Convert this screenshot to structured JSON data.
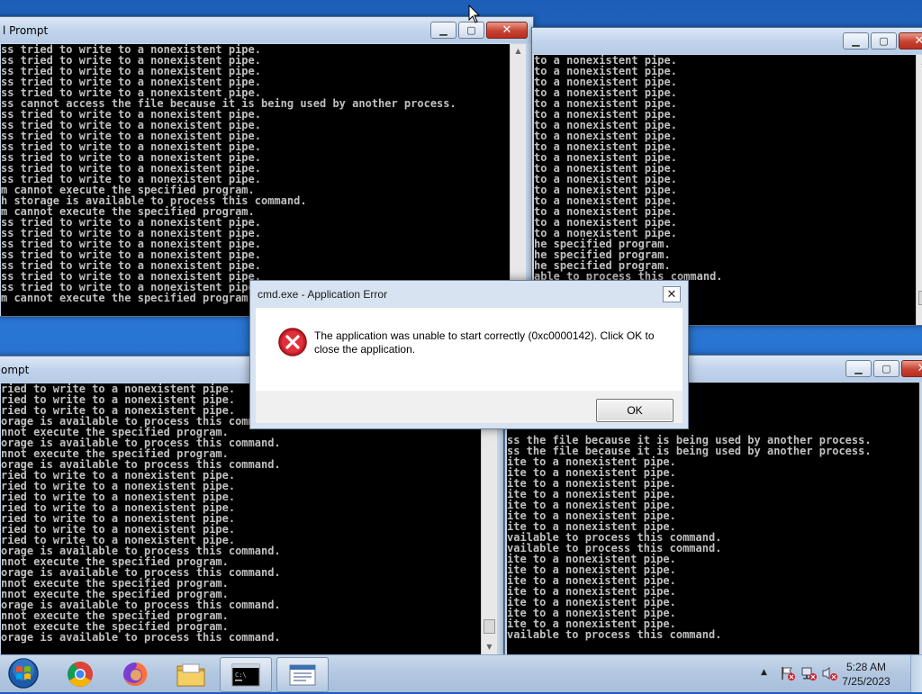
{
  "windows": {
    "top_left": {
      "title": "l Prompt",
      "lines": [
        "ss tried to write to a nonexistent pipe.",
        "ss tried to write to a nonexistent pipe.",
        "ss tried to write to a nonexistent pipe.",
        "ss tried to write to a nonexistent pipe.",
        "ss tried to write to a nonexistent pipe.",
        "ss cannot access the file because it is being used by another process.",
        "ss tried to write to a nonexistent pipe.",
        "ss tried to write to a nonexistent pipe.",
        "ss tried to write to a nonexistent pipe.",
        "ss tried to write to a nonexistent pipe.",
        "ss tried to write to a nonexistent pipe.",
        "ss tried to write to a nonexistent pipe.",
        "ss tried to write to a nonexistent pipe.",
        "m cannot execute the specified program.",
        "h storage is available to process this command.",
        "m cannot execute the specified program.",
        "ss tried to write to a nonexistent pipe.",
        "ss tried to write to a nonexistent pipe.",
        "ss tried to write to a nonexistent pipe.",
        "ss tried to write to a nonexistent pipe.",
        "ss tried to write to a nonexistent pipe.",
        "ss tried to write to a nonexistent pipe.",
        "ss tried to write to a nonexistent pipe.",
        "m cannot execute the specified program."
      ]
    },
    "top_right": {
      "title": "",
      "lines": [
        "to a nonexistent pipe.",
        "to a nonexistent pipe.",
        "to a nonexistent pipe.",
        "to a nonexistent pipe.",
        "to a nonexistent pipe.",
        "to a nonexistent pipe.",
        "to a nonexistent pipe.",
        "to a nonexistent pipe.",
        "to a nonexistent pipe.",
        "to a nonexistent pipe.",
        "to a nonexistent pipe.",
        "to a nonexistent pipe.",
        "to a nonexistent pipe.",
        "to a nonexistent pipe.",
        "to a nonexistent pipe.",
        "to a nonexistent pipe.",
        "to a nonexistent pipe.",
        "he specified program.",
        "he specified program.",
        "he specified program.",
        "able to process this command."
      ]
    },
    "bottom_left": {
      "title": "ompt",
      "lines": [
        "ried to write to a nonexistent pipe.",
        "ried to write to a nonexistent pipe.",
        "ried to write to a nonexistent pipe.",
        "orage is available to process this command.",
        "nnot execute the specified program.",
        "orage is available to process this command.",
        "nnot execute the specified program.",
        "orage is available to process this command.",
        "ried to write to a nonexistent pipe.",
        "ried to write to a nonexistent pipe.",
        "ried to write to a nonexistent pipe.",
        "ried to write to a nonexistent pipe.",
        "ried to write to a nonexistent pipe.",
        "ried to write to a nonexistent pipe.",
        "ried to write to a nonexistent pipe.",
        "orage is available to process this command.",
        "nnot execute the specified program.",
        "orage is available to process this command.",
        "nnot execute the specified program.",
        "nnot execute the specified program.",
        "orage is available to process this command.",
        "nnot execute the specified program.",
        "nnot execute the specified program.",
        "orage is available to process this command."
      ]
    },
    "bottom_right": {
      "title": "",
      "lines": [
        "ss the file because it is being used by another process.",
        "ss the file because it is being used by another process.",
        "ite to a nonexistent pipe.",
        "ite to a nonexistent pipe.",
        "ite to a nonexistent pipe.",
        "ite to a nonexistent pipe.",
        "ite to a nonexistent pipe.",
        "ite to a nonexistent pipe.",
        "ite to a nonexistent pipe.",
        "vailable to process this command.",
        "vailable to process this command.",
        "ite to a nonexistent pipe.",
        "ite to a nonexistent pipe.",
        "ite to a nonexistent pipe.",
        "ite to a nonexistent pipe.",
        "ite to a nonexistent pipe.",
        "ite to a nonexistent pipe.",
        "ite to a nonexistent pipe.",
        "vailable to process this command."
      ]
    }
  },
  "dialog": {
    "title": "cmd.exe - Application Error",
    "close_glyph": "✕",
    "message": "The application was unable to start correctly (0xc0000142). Click OK to close the application.",
    "ok_label": "OK"
  },
  "taskbar": {
    "icons": [
      "start-orb-icon",
      "chrome-icon",
      "firefox-icon",
      "file-explorer-icon",
      "command-prompt-icon",
      "app-window-icon"
    ],
    "tray_arrow": "▲",
    "time": "5:28 AM",
    "date": "7/25/2023"
  },
  "window_buttons": {
    "minimize": "▁",
    "maximize": "▢",
    "close": "✕"
  },
  "colors": {
    "console_text": "#c0c0c0",
    "console_bg": "#000000",
    "desktop": "#2b78d6",
    "error_red": "#d0202a"
  }
}
